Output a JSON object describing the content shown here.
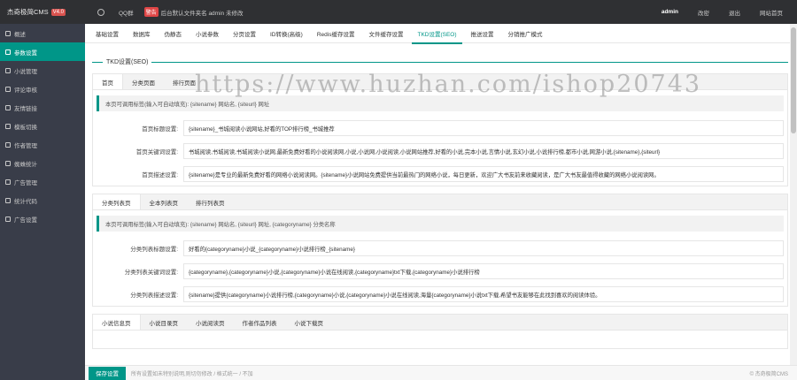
{
  "topbar": {
    "brand": "杰奇极简CMS",
    "version": "V4.0",
    "qq_link": "QQ群",
    "warning_tag": "警告",
    "warning_text": "后台默认文件夹名 admin 未修改",
    "user": "admin",
    "change_password": "改密",
    "logout": "退出",
    "site_home": "网站首页"
  },
  "sidebar": {
    "items": [
      {
        "label": "概述",
        "icon": "info-icon"
      },
      {
        "label": "参数设置",
        "icon": "gear-icon"
      },
      {
        "label": "小说管理",
        "icon": "book-icon"
      },
      {
        "label": "评论审核",
        "icon": "shield-icon"
      },
      {
        "label": "友情链接",
        "icon": "link-icon"
      },
      {
        "label": "模板切换",
        "icon": "template-icon"
      },
      {
        "label": "作者管理",
        "icon": "user-icon"
      },
      {
        "label": "蜘蛛统计",
        "icon": "chart-icon"
      },
      {
        "label": "广告管理",
        "icon": "ad-icon"
      },
      {
        "label": "统计代码",
        "icon": "code-icon"
      },
      {
        "label": "广告设置",
        "icon": "ad-setting-icon"
      }
    ]
  },
  "tabs": [
    "基础设置",
    "数据库",
    "伪静态",
    "小说参数",
    "分页设置",
    "ID转换(高级)",
    "Redis缓存设置",
    "文件缓存设置",
    "TKD设置(SEO)",
    "推送设置",
    "分销推广模式"
  ],
  "section_title": "TKD设置(SEO)",
  "panel1": {
    "tabs": [
      "首页",
      "分类页面",
      "排行页面"
    ],
    "notice": "本页可调用标签(输入可自动填充): {sitename} 网站名, {siteurl} 网址",
    "fields": [
      {
        "label": "首页标题设置:",
        "value": "{sitename}_书城阅读小说网站,好看的TOP排行榜_书城推荐"
      },
      {
        "label": "首页关键词设置:",
        "value": "书城阅读,书城阅读,书城阅读小说网,最新免费好看的小说阅读网,小说,小说网,小说阅读,小说网站推荐,好看的小说,完本小说,言情小说,玄幻小说,小说排行榜,都市小说,网游小说,{sitename},{siteurl}"
      },
      {
        "label": "首页描述设置:",
        "value": "{sitename}是专业的最新免费好看的网络小说阅读网。{sitename}小说网站免费提供当前最热门的网络小说，每日更新，欢迎广大书友前来收藏阅读，是广大书友最值得收藏的网络小说阅读网。"
      }
    ]
  },
  "panel2": {
    "tabs": [
      "分类列表页",
      "全本列表页",
      "排行列表页"
    ],
    "notice": "本页可调用标签(输入可自动填充): {sitename} 网站名, {siteurl} 网址, {categoryname} 分类名称",
    "fields": [
      {
        "label": "分类列表标题设置:",
        "value": "好看的{categoryname}小说_{categoryname}小说排行榜_{sitename}"
      },
      {
        "label": "分类列表关键词设置:",
        "value": "{categoryname},{categoryname}小说,{categoryname}小说在线阅读,{categoryname}txt下载,{categoryname}小说排行榜"
      },
      {
        "label": "分类列表描述设置:",
        "value": "{sitename}提供{categoryname}小说排行榜,{categoryname}小说,{categoryname}小说在线阅读,海量{categoryname}小说txt下载,希望书友能够在此找到喜欢的阅读体验。"
      }
    ]
  },
  "panel3": {
    "tabs": [
      "小说信息页",
      "小说目录页",
      "小说阅读页",
      "作者作品列表",
      "小说下载页"
    ]
  },
  "footer": {
    "save_label": "保存设置",
    "note": "所有设置如未特别说明,则切勿修改 / 格式统一 / 不加",
    "copyright": "© 杰奇极简CMS"
  },
  "watermark": "https://www.huzhan.com/ishop20743",
  "colors": {
    "accent": "#009688",
    "sidebar_bg": "#393d49",
    "topbar_bg": "#2f3033",
    "warning": "#e04646"
  }
}
